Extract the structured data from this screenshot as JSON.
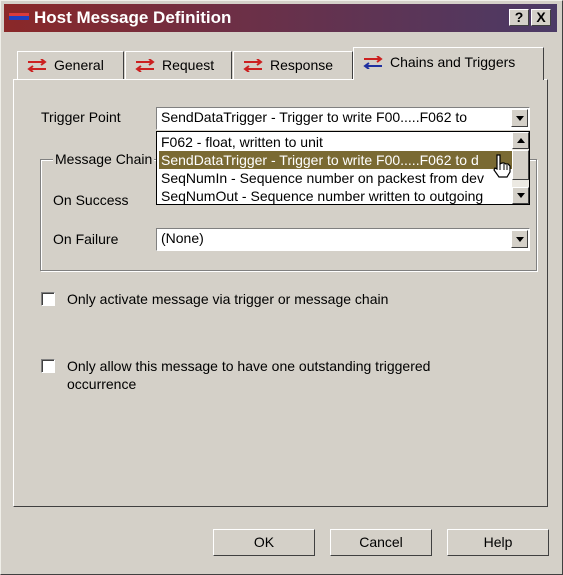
{
  "window": {
    "title": "Host Message Definition",
    "help_btn": "?",
    "close_btn": "X"
  },
  "tabs": [
    {
      "label": "General",
      "icon": "swap-arrows-icon"
    },
    {
      "label": "Request",
      "icon": "swap-arrows-icon"
    },
    {
      "label": "Response",
      "icon": "swap-arrows-icon"
    },
    {
      "label": "Chains and Triggers",
      "icon": "swap-arrows-icon",
      "active": true
    }
  ],
  "trigger": {
    "label": "Trigger Point",
    "value": "SendDataTrigger - Trigger to write F00.....F062 to",
    "options": [
      "F062 - float, written to unit",
      "SendDataTrigger - Trigger to write F00.....F062 to d",
      "SeqNumIn - Sequence number on packest from dev",
      "SeqNumOut - Sequence number written to outgoing"
    ],
    "selected_index": 1
  },
  "chain": {
    "group_label": "Message Chain",
    "success_label": "On Success",
    "failure_label": "On Failure",
    "failure_value": "(None)"
  },
  "options": {
    "only_activate": "Only activate message via trigger or message chain",
    "only_allow_line1": "Only allow this message to have one outstanding triggered",
    "only_allow_line2": "occurrence"
  },
  "buttons": {
    "ok": "OK",
    "cancel": "Cancel",
    "help": "Help"
  },
  "colors": {
    "title_gradient_start": "#8a2828",
    "title_gradient_end": "#4b3a66",
    "face": "#d4d0c8",
    "selection": "#7a6a33",
    "icon_red": "#cc2020",
    "icon_blue": "#2030a0"
  }
}
